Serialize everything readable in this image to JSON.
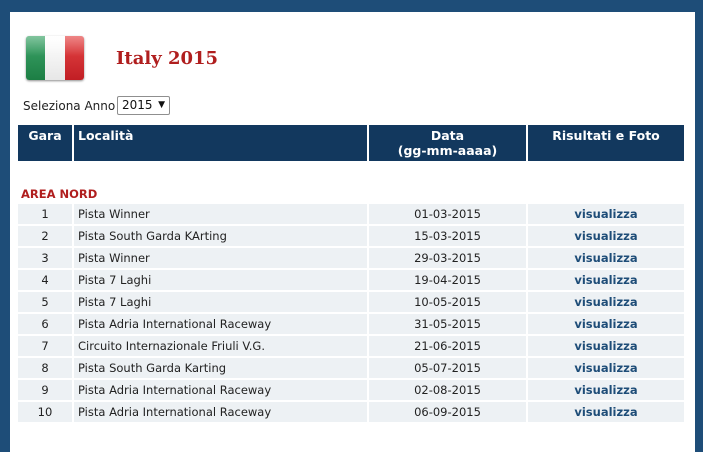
{
  "header": {
    "title": "Italy 2015"
  },
  "year_selector": {
    "label": "Seleziona Anno",
    "selected": "2015"
  },
  "table": {
    "columns": {
      "race": "Gara",
      "location": "Località",
      "date_line1": "Data",
      "date_line2": "(gg-mm-aaaa)",
      "results": "Risultati e Foto"
    },
    "section_title": "AREA NORD",
    "rows": [
      {
        "num": "1",
        "location": "Pista Winner",
        "date": "01-03-2015",
        "link": "visualizza"
      },
      {
        "num": "2",
        "location": "Pista South Garda KArting",
        "date": "15-03-2015",
        "link": "visualizza"
      },
      {
        "num": "3",
        "location": "Pista Winner",
        "date": "29-03-2015",
        "link": "visualizza"
      },
      {
        "num": "4",
        "location": "Pista 7 Laghi",
        "date": "19-04-2015",
        "link": "visualizza"
      },
      {
        "num": "5",
        "location": "Pista 7 Laghi",
        "date": "10-05-2015",
        "link": "visualizza"
      },
      {
        "num": "6",
        "location": "Pista Adria International Raceway",
        "date": "31-05-2015",
        "link": "visualizza"
      },
      {
        "num": "7",
        "location": "Circuito Internazionale Friuli V.G.",
        "date": "21-06-2015",
        "link": "visualizza"
      },
      {
        "num": "8",
        "location": "Pista South Garda Karting",
        "date": "05-07-2015",
        "link": "visualizza"
      },
      {
        "num": "9",
        "location": "Pista Adria International Raceway",
        "date": "02-08-2015",
        "link": "visualizza"
      },
      {
        "num": "10",
        "location": "Pista Adria International Raceway",
        "date": "06-09-2015",
        "link": "visualizza"
      }
    ]
  }
}
